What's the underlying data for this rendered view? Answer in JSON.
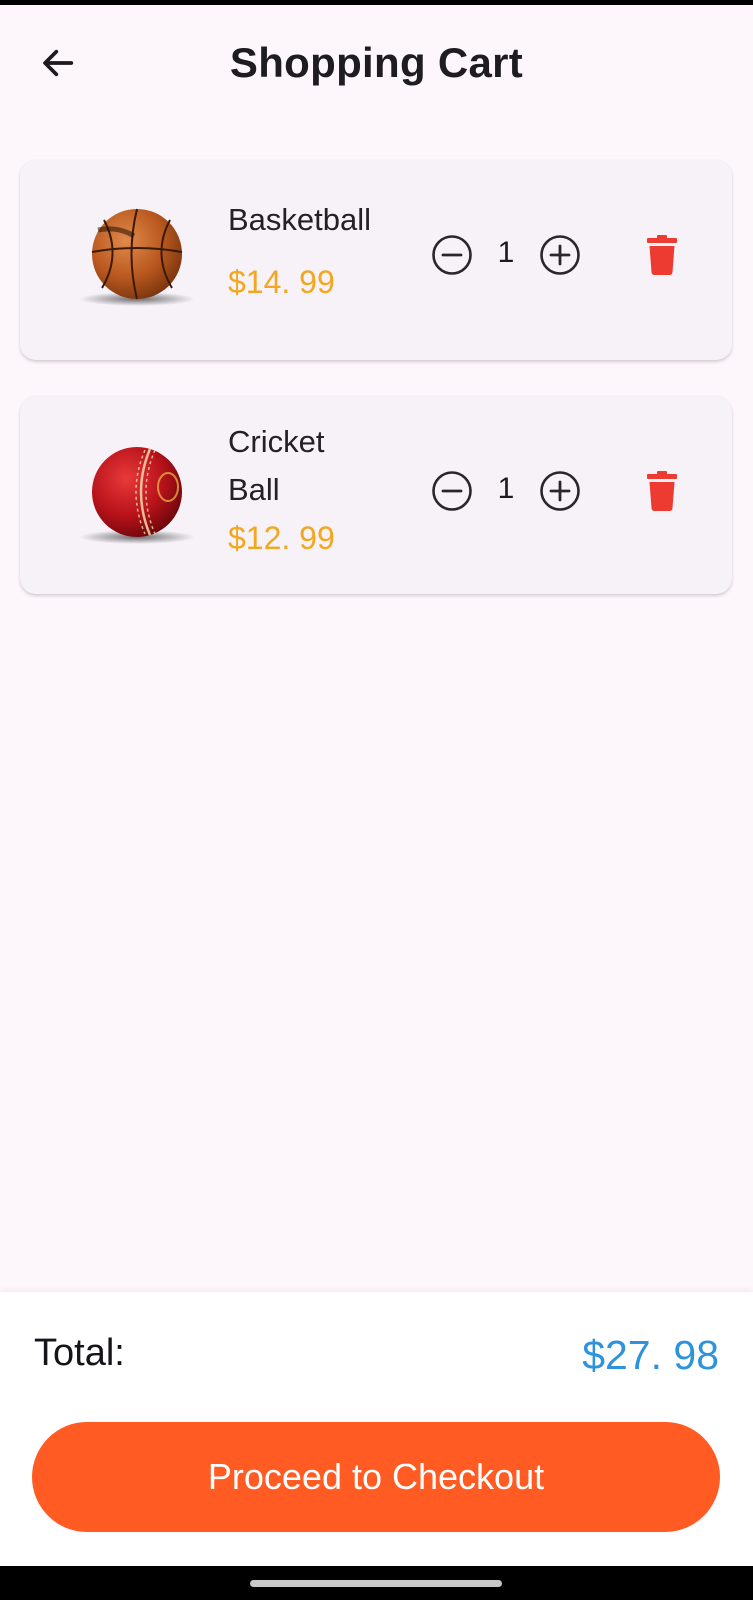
{
  "header": {
    "title": "Shopping Cart",
    "back_icon": "arrow-left-icon"
  },
  "cart": {
    "items": [
      {
        "name_lines": [
          "Basketball"
        ],
        "price": "$14. 99",
        "quantity": "1",
        "image": "basketball-image"
      },
      {
        "name_lines": [
          "Cricket",
          "Ball"
        ],
        "price": "$12. 99",
        "quantity": "1",
        "image": "cricket-ball-image"
      }
    ],
    "icons": {
      "decrease": "minus-circle-icon",
      "increase": "plus-circle-icon",
      "delete": "trash-icon"
    }
  },
  "footer": {
    "total_label": "Total:",
    "total_value": "$27. 98",
    "checkout_label": "Proceed to Checkout"
  },
  "colors": {
    "background": "#fdf6fb",
    "card": "#f6f2f8",
    "price": "#f2a720",
    "total": "#2f93dc",
    "checkout": "#ff5b22",
    "delete": "#ee3b31"
  }
}
